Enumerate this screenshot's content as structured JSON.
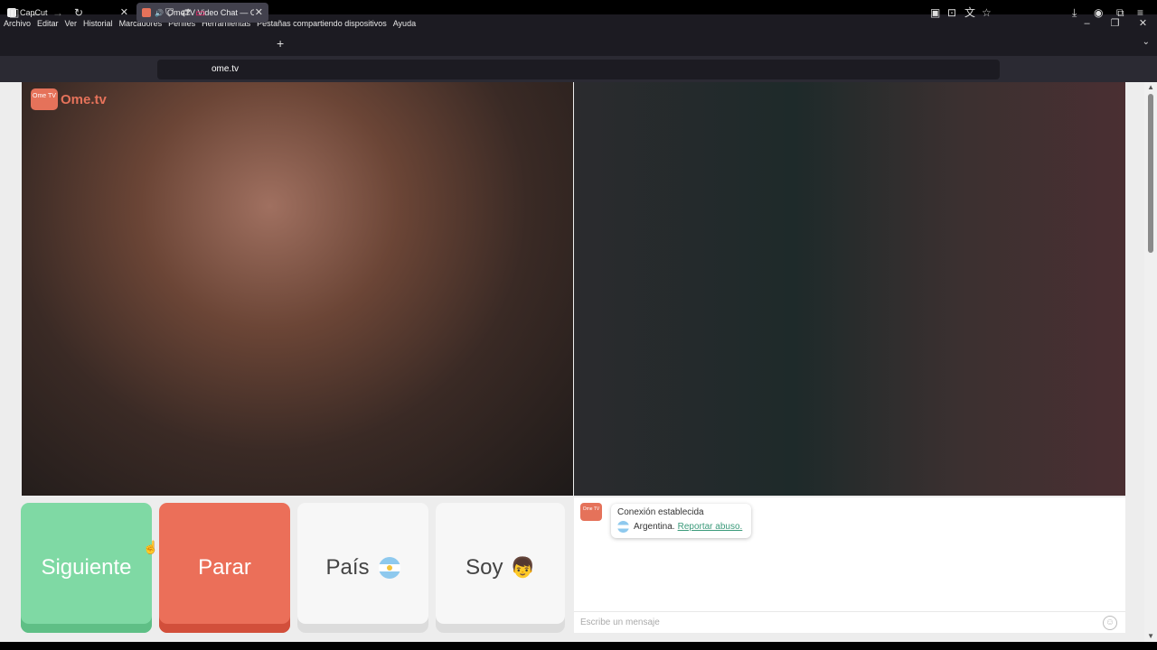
{
  "menubar": {
    "items": [
      "Archivo",
      "Editar",
      "Ver",
      "Historial",
      "Marcadores",
      "Perfiles",
      "Herramientas",
      "Pestañas compartiendo dispositivos",
      "Ayuda"
    ]
  },
  "window_controls": [
    "–",
    "❐",
    "✕"
  ],
  "tabs": [
    {
      "title": "CapCut",
      "favicon_color": "#f0f0f0"
    },
    {
      "title": "OmeTV Video Chat — Ome",
      "favicon_color": "#e5725a",
      "audio": "🔊"
    }
  ],
  "navbar": {
    "url": "ome.tv"
  },
  "site": {
    "logo_box": "Ome TV",
    "logo_text": "Ome.tv"
  },
  "buttons": {
    "next": "Siguiente",
    "stop": "Parar",
    "country": "País",
    "me": "Soy",
    "me_emoji": "👦"
  },
  "chat": {
    "logo": "Ome TV",
    "status": "Conexión establecida",
    "country": "Argentina.",
    "report": "Reportar abuso.",
    "placeholder": "Escribe un mensaje",
    "emoji_icon": "☺"
  }
}
